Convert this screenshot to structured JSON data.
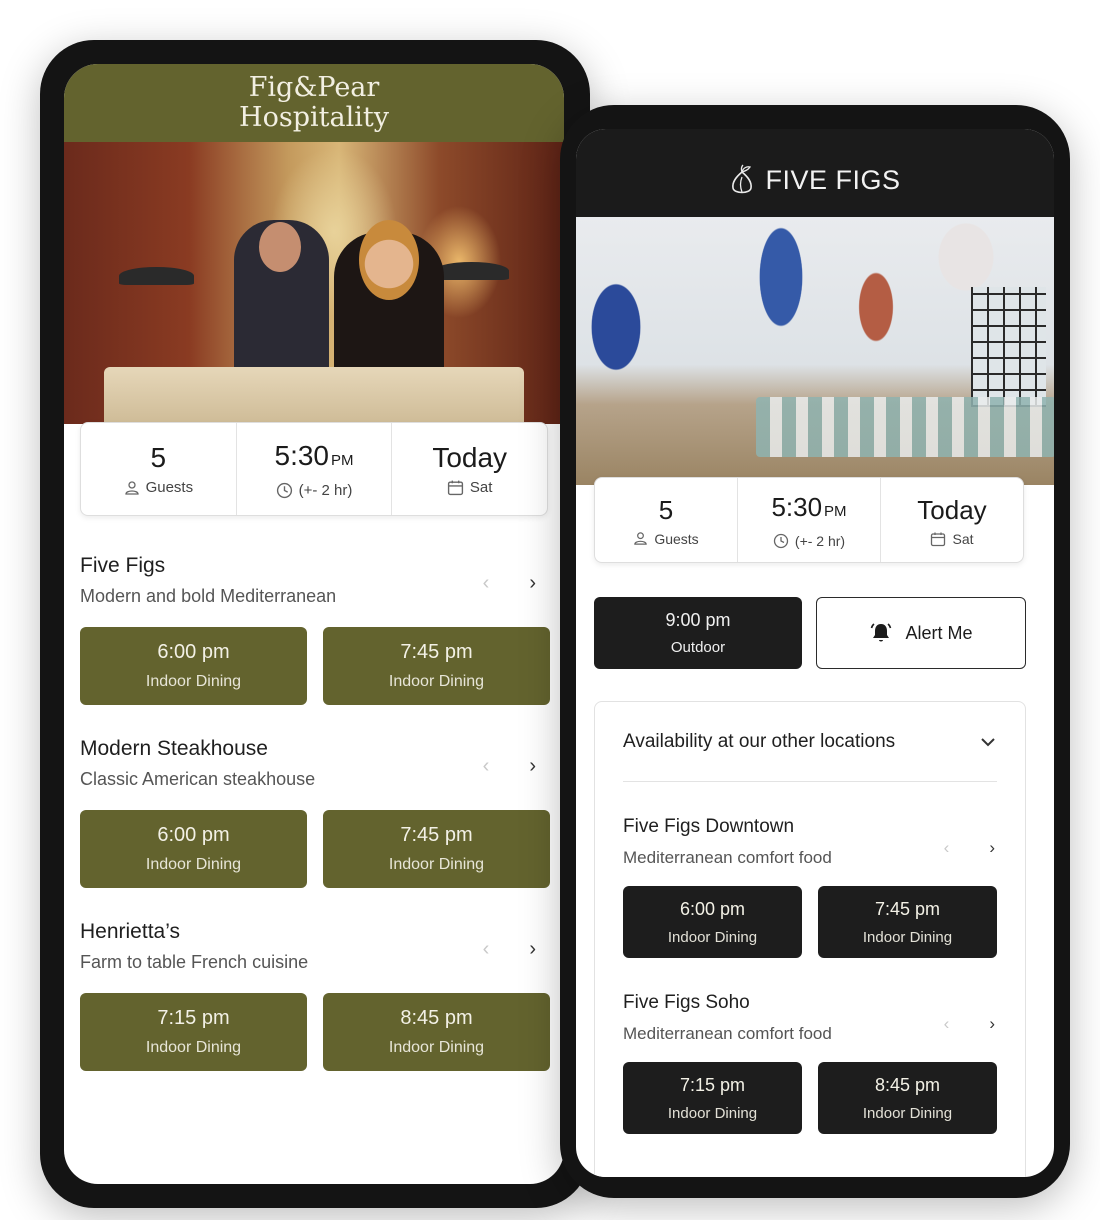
{
  "left_app": {
    "brand_line1": "Fig&Pear",
    "brand_line2": "Hospitality",
    "summary": {
      "guests_count": "5",
      "guests_label": "Guests",
      "time": "5:30",
      "time_ampm": "PM",
      "time_range": "(+- 2 hr)",
      "date": "Today",
      "day": "Sat"
    },
    "restaurants": [
      {
        "name": "Five Figs",
        "description": "Modern and bold Mediterranean",
        "slots": [
          {
            "time": "6:00 pm",
            "kind": "Indoor Dining"
          },
          {
            "time": "7:45 pm",
            "kind": "Indoor Dining"
          }
        ]
      },
      {
        "name": "Modern Steakhouse",
        "description": "Classic American steakhouse",
        "slots": [
          {
            "time": "6:00 pm",
            "kind": "Indoor Dining"
          },
          {
            "time": "7:45 pm",
            "kind": "Indoor Dining"
          }
        ]
      },
      {
        "name": "Henrietta’s",
        "description": "Farm to table French cuisine",
        "slots": [
          {
            "time": "7:15 pm",
            "kind": "Indoor Dining"
          },
          {
            "time": "8:45 pm",
            "kind": "Indoor Dining"
          }
        ]
      }
    ],
    "accent_color": "#63632e"
  },
  "right_app": {
    "brand": "FIVE FIGS",
    "brand_icon": "fig-icon",
    "summary": {
      "guests_count": "5",
      "guests_label": "Guests",
      "time": "5:30",
      "time_ampm": "PM",
      "time_range": "(+- 2 hr)",
      "date": "Today",
      "day": "Sat"
    },
    "primary_slot": {
      "time": "9:00 pm",
      "kind": "Outdoor"
    },
    "alert_label": "Alert Me",
    "availability_title": "Availability at our other locations",
    "locations": [
      {
        "name": "Five Figs Downtown",
        "description": "Mediterranean comfort food",
        "slots": [
          {
            "time": "6:00 pm",
            "kind": "Indoor Dining"
          },
          {
            "time": "7:45 pm",
            "kind": "Indoor Dining"
          }
        ]
      },
      {
        "name": "Five Figs Soho",
        "description": "Mediterranean comfort food",
        "slots": [
          {
            "time": "7:15 pm",
            "kind": "Indoor Dining"
          },
          {
            "time": "8:45 pm",
            "kind": "Indoor Dining"
          }
        ]
      }
    ],
    "accent_color": "#1d1d1d"
  },
  "icons": {
    "prev": "‹",
    "next": "›"
  }
}
